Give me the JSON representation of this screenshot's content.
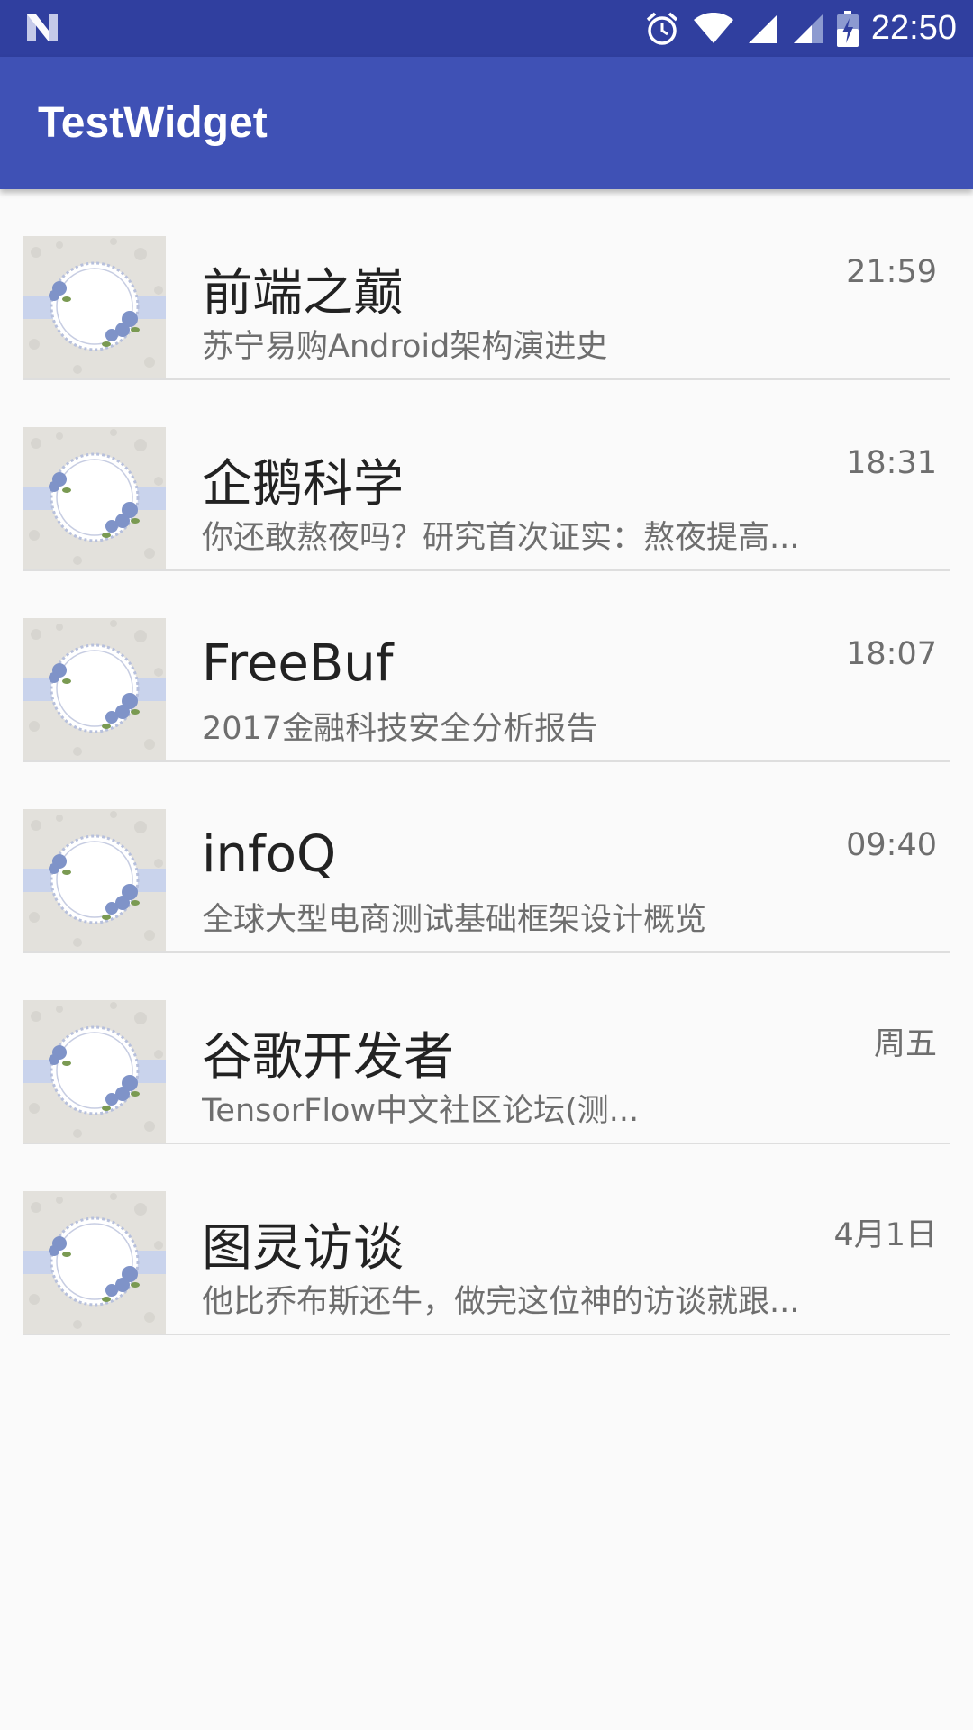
{
  "status_bar": {
    "time": "22:50",
    "icons": [
      "n-logo-icon",
      "alarm-icon",
      "wifi-icon",
      "signal-icon",
      "signal-icon",
      "battery-charging-icon"
    ],
    "background_color": "#303f9f"
  },
  "app_bar": {
    "title": "TestWidget",
    "background_color": "#3f51b5"
  },
  "list": {
    "items": [
      {
        "title": "前端之巅",
        "subtitle": "苏宁易购Android架构演进史",
        "time": "21:59",
        "thumbnail": "floral-frame-thumbnail"
      },
      {
        "title": "企鹅科学",
        "subtitle": "你还敢熬夜吗？研究首次证实：熬夜提高...",
        "time": "18:31",
        "thumbnail": "floral-frame-thumbnail"
      },
      {
        "title": "FreeBuf",
        "subtitle": "2017金融科技安全分析报告",
        "time": "18:07",
        "thumbnail": "floral-frame-thumbnail"
      },
      {
        "title": "infoQ",
        "subtitle": "全球大型电商测试基础框架设计概览",
        "time": "09:40",
        "thumbnail": "floral-frame-thumbnail"
      },
      {
        "title": "谷歌开发者",
        "subtitle": "TensorFlow中文社区论坛(测...",
        "time": "周五",
        "thumbnail": "floral-frame-thumbnail"
      },
      {
        "title": "图灵访谈",
        "subtitle": "他比乔布斯还牛，做完这位神的访谈就跟...",
        "time": "4月1日",
        "thumbnail": "floral-frame-thumbnail"
      }
    ]
  }
}
